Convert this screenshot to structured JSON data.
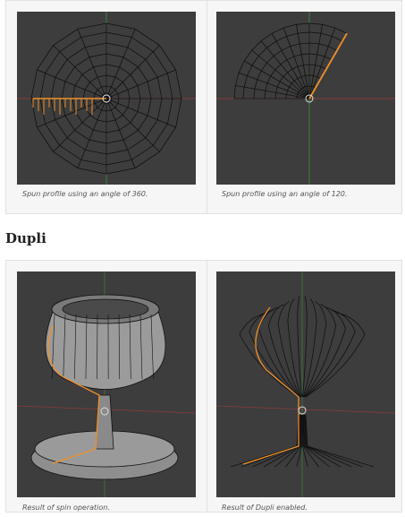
{
  "figures_top": [
    {
      "caption": "Spun profile using an angle of 360."
    },
    {
      "caption": "Spun profile using an angle of 120."
    }
  ],
  "section": {
    "heading": "Dupli"
  },
  "figures_bottom": [
    {
      "caption": "Result of spin operation."
    },
    {
      "caption": "Result of Dupli enabled."
    }
  ],
  "colors": {
    "viewport_bg": "#3d3d3d",
    "wire": "#111111",
    "selected": "#f0902a",
    "axis_x": "#8a3b3b",
    "axis_y": "#3f7a3f",
    "mesh_fill": "#8a8a8a"
  }
}
